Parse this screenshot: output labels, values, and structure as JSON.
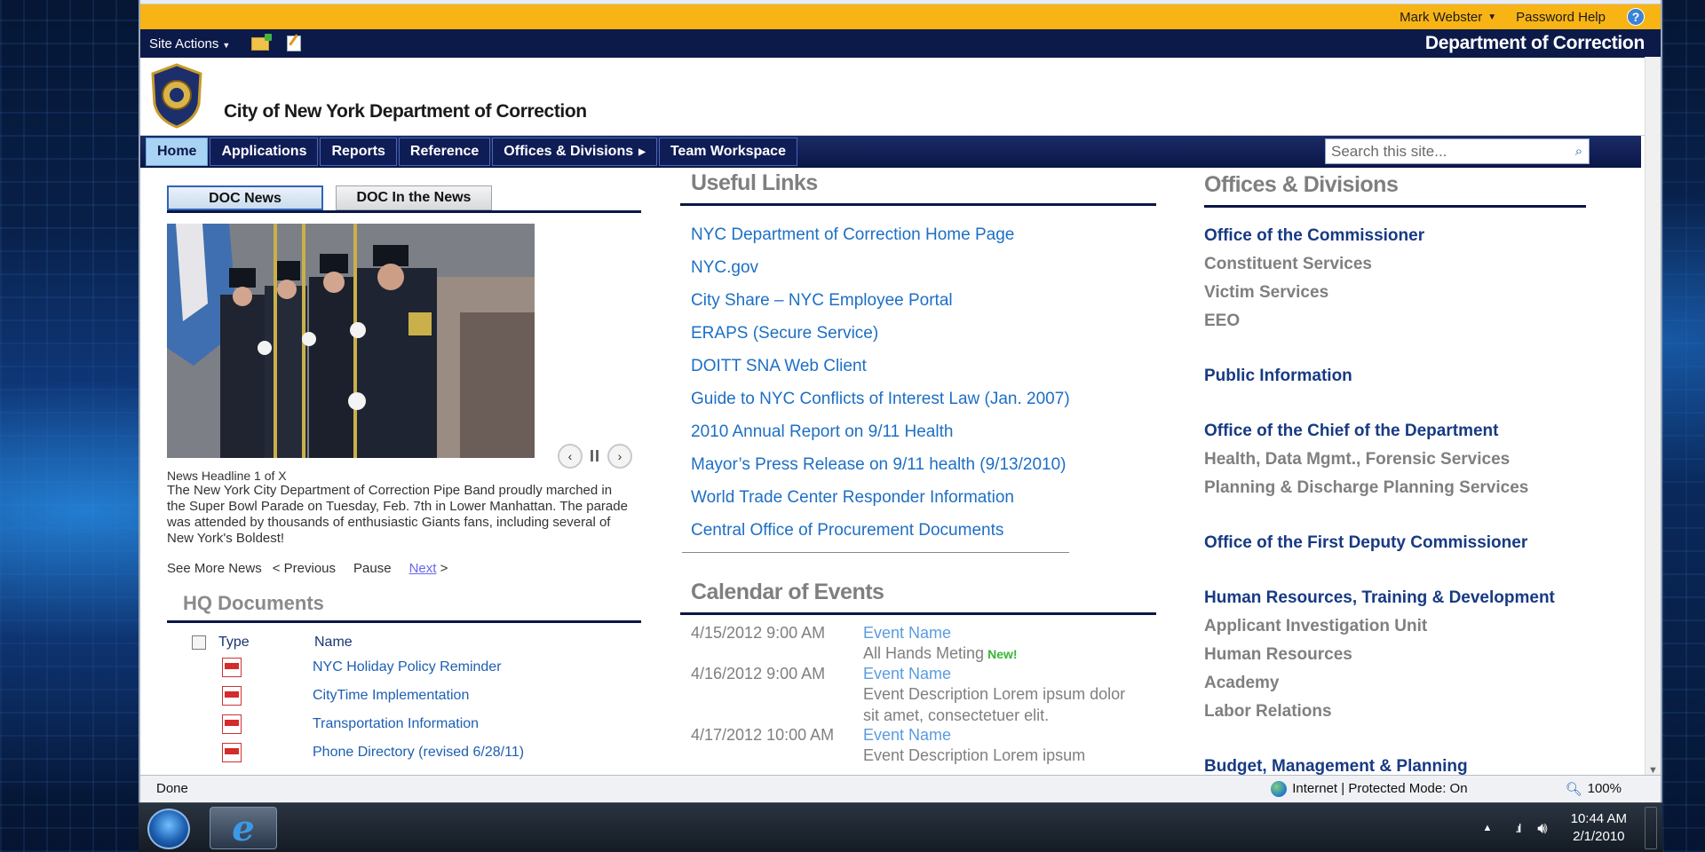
{
  "topbar": {
    "user_name": "Mark Webster",
    "password_help": "Password Help",
    "help_glyph": "?"
  },
  "actions_bar": {
    "site_actions": "Site Actions",
    "department": "Department of Correction"
  },
  "header": {
    "org_title": "City of New York Department of Correction"
  },
  "nav": {
    "items": [
      "Home",
      "Applications",
      "Reports",
      "Reference",
      "Offices & Divisions",
      "Team Workspace"
    ],
    "search_placeholder": "Search this site..."
  },
  "news": {
    "tabs": [
      "DOC News",
      "DOC In the News"
    ],
    "headline_count": "News Headline 1 of X",
    "body": "The New York City Department of Correction Pipe Band proudly marched in the Super Bowl Parade on Tuesday, Feb. 7th in Lower Manhattan. The parade was attended by thousands of enthusiastic Giants fans, including several of New York's Boldest!",
    "see_more": "See More News",
    "previous": "< Previous",
    "pause": "Pause",
    "next": "Next",
    "next_suffix": ">"
  },
  "hq_documents": {
    "title": "HQ Documents",
    "col_type": "Type",
    "col_name": "Name",
    "rows": [
      "NYC Holiday Policy Reminder",
      "CityTime Implementation",
      "Transportation Information",
      "Phone Directory (revised 6/28/11)"
    ]
  },
  "useful_links": {
    "title": "Useful Links",
    "items": [
      "NYC Department of Correction Home Page",
      "NYC.gov",
      "City Share – NYC Employee Portal",
      "ERAPS (Secure Service)",
      "DOITT SNA Web Client",
      "Guide to NYC Conflicts of Interest Law (Jan. 2007)",
      "2010 Annual Report on 9/11 Health",
      "Mayor’s Press Release on 9/11 health (9/13/2010)",
      "World Trade Center Responder Information",
      "Central Office of Procurement Documents"
    ]
  },
  "calendar": {
    "title": "Calendar of Events",
    "new_badge": "New!",
    "events": [
      {
        "date": "4/15/2012 9:00 AM",
        "name": "Event Name",
        "desc": "All Hands Meting"
      },
      {
        "date": "4/16/2012 9:00 AM",
        "name": "Event Name",
        "desc": "Event Description Lorem ipsum dolor sit amet, consectetuer elit."
      },
      {
        "date": "4/17/2012 10:00 AM",
        "name": "Event Name",
        "desc": "Event Description Lorem ipsum"
      }
    ]
  },
  "offices": {
    "title": "Offices & Divisions",
    "groups": [
      {
        "head": "Office of the Commissioner",
        "subs": [
          "Constituent Services",
          "Victim Services",
          "EEO"
        ]
      },
      {
        "head": "Public Information",
        "subs": []
      },
      {
        "head": "Office of the Chief of the Department",
        "subs": [
          "Health, Data Mgmt., Forensic Services",
          "Planning & Discharge Planning Services"
        ]
      },
      {
        "head": "Office of the First Deputy Commissioner",
        "subs": []
      },
      {
        "head": "Human Resources, Training & Development",
        "subs": [
          "Applicant Investigation Unit",
          "Human Resources",
          "Academy",
          "Labor Relations"
        ]
      },
      {
        "head": "Budget, Management & Planning",
        "subs": []
      }
    ]
  },
  "statusbar": {
    "done": "Done",
    "zone": "Internet | Protected Mode: On",
    "zoom": "100%"
  },
  "taskbar": {
    "time": "10:44 AM",
    "date": "2/1/2010"
  },
  "colors": {
    "gold": "#f8b414",
    "navy": "#0b1647",
    "link_blue": "#1d6fc5",
    "office_head": "#173a83",
    "gray_text": "#7f7f7f"
  }
}
